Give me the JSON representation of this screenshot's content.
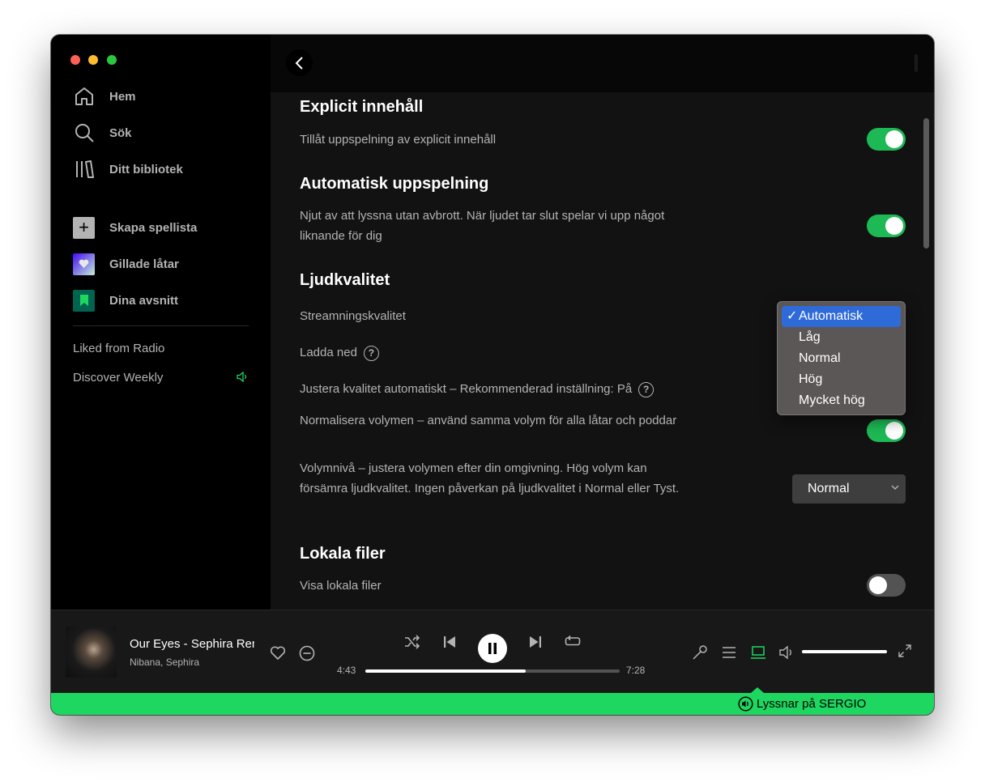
{
  "sidebar": {
    "nav": [
      {
        "label": "Hem",
        "icon": "home-icon"
      },
      {
        "label": "Sök",
        "icon": "search-icon"
      },
      {
        "label": "Ditt bibliotek",
        "icon": "library-icon"
      }
    ],
    "actions": [
      {
        "label": "Skapa spellista",
        "icon": "plus-icon"
      },
      {
        "label": "Gillade låtar",
        "icon": "heart-icon"
      },
      {
        "label": "Dina avsnitt",
        "icon": "bookmark-icon"
      }
    ],
    "playlists": [
      {
        "label": "Liked from Radio"
      },
      {
        "label": "Discover Weekly",
        "playing": true
      }
    ]
  },
  "settings": {
    "explicit": {
      "heading": "Explicit innehåll",
      "label": "Tillåt uppspelning av explicit innehåll",
      "enabled": true
    },
    "autoplay": {
      "heading": "Automatisk uppspelning",
      "label": "Njut av att lyssna utan avbrott. När ljudet tar slut spelar vi upp något liknande för dig",
      "enabled": true
    },
    "quality": {
      "heading": "Ljudkvalitet",
      "streaming_label": "Streamningskvalitet",
      "download_label": "Ladda ned",
      "auto_adjust_label": "Justera kvalitet automatiskt – Rekommenderad inställning: På",
      "normalize_label": "Normalisera volymen – använd samma volym för alla låtar och poddar",
      "normalize_enabled": true,
      "volume_level_label": "Volymnivå – justera volymen efter din omgivning. Hög volym kan försämra ljudkvalitet. Ingen påverkan på ljudkvalitet i Normal eller Tyst.",
      "volume_level_value": "Normal"
    },
    "local_files": {
      "heading": "Lokala filer",
      "label": "Visa lokala filer",
      "enabled": false
    }
  },
  "dropdown": {
    "options": [
      "Automatisk",
      "Låg",
      "Normal",
      "Hög",
      "Mycket hög"
    ],
    "selected": "Automatisk",
    "check": "✓"
  },
  "player": {
    "title": "Our Eyes - Sephira Remix",
    "artist": "Nibana, Sephira",
    "elapsed": "4:43",
    "duration": "7:28",
    "progress": 0.63,
    "volume": 1.0
  },
  "banner": {
    "text": "Lyssnar på SERGIO"
  },
  "colors": {
    "accent": "#1ed760",
    "toggle_on": "#1db954",
    "dropdown_selected": "#2f6ad9"
  }
}
